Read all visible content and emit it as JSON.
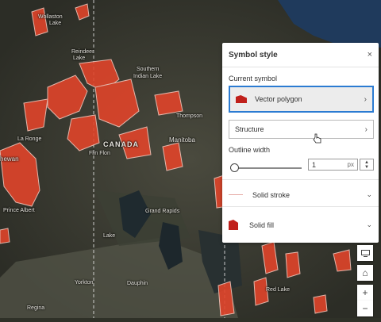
{
  "panel": {
    "title": "Symbol style",
    "close": "×",
    "current_symbol_label": "Current symbol",
    "current_symbol_value": "Vector polygon",
    "structure_label": "Structure",
    "outline_width_label": "Outline width",
    "outline_width_value": "1",
    "outline_width_unit": "px",
    "stroke_label": "Solid stroke",
    "fill_label": "Solid fill",
    "chevron_right": "›",
    "chevron_down": "⌄",
    "stepper_up": "▲",
    "stepper_down": "▼"
  },
  "map_labels": {
    "wollaston": "Wollaston",
    "lake": "Lake",
    "reindeer": "Reindeer",
    "reindeer_lake": "Lake",
    "southern": "Southern",
    "indian_lake": "Indian Lake",
    "thompson": "Thompson",
    "la_ronge": "La Ronge",
    "flin_flon": "Flin Flon",
    "canada": "CANADA",
    "manitoba": "Manitoba",
    "sask": "hewan",
    "prince_albert": "Prince Albert",
    "grand_rapids": "Grand Rapids",
    "winnipegosis": "Lake",
    "yorkton": "Yorkton",
    "dauphin": "Dauphin",
    "red_lake": "Red Lake",
    "regina": "Regina"
  },
  "map_controls": {
    "home_icon": "⌂",
    "zoom_in": "+",
    "zoom_out": "−"
  },
  "colors": {
    "accent": "#2b7bd2",
    "fill": "#c0201b",
    "stroke": "#e5a8a3"
  }
}
